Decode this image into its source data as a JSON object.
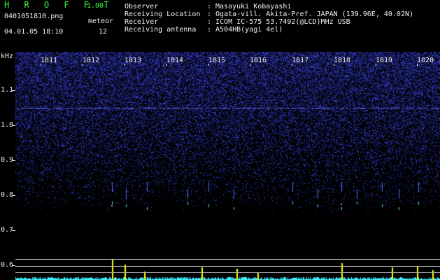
{
  "header": {
    "app_title": "H R O F F T",
    "version": "1.00",
    "filename": "0401051810.png",
    "datetime": "04.01.05 18:10",
    "counter_label": "meteor",
    "counter_value": "12",
    "info": [
      {
        "label": "Observer",
        "value": ": Masayuki Kobayashi"
      },
      {
        "label": "Receiving Location",
        "value": ": Ogata-vill. Akita-Pref. JAPAN (139.96E, 40.02N)"
      },
      {
        "label": "Receiver",
        "value": ": ICOM IC-575 53.7492(@LCD)MHz USB"
      },
      {
        "label": "Receiving antenna",
        "value": ": A504HB(yagi 4el)"
      }
    ]
  },
  "spectrogram": {
    "y_unit": "kHz",
    "y_ticks": [
      "1.1",
      "1.0",
      "0.9",
      "0.8",
      "0.7",
      "0.6"
    ],
    "x_ticks": [
      "1811",
      "1812",
      "1813",
      "1814",
      "1815",
      "1816",
      "1817",
      "1818",
      "1819",
      "1820"
    ],
    "colors": {
      "background": "#000000",
      "noise": "#2a3cc8",
      "carrier_line": "#5a6cff",
      "signal_cyan": "#40f0ff",
      "signal_yellow": "#ffff00",
      "text_green": "#3fff3f",
      "text_white": "#f0f0f0"
    }
  }
}
